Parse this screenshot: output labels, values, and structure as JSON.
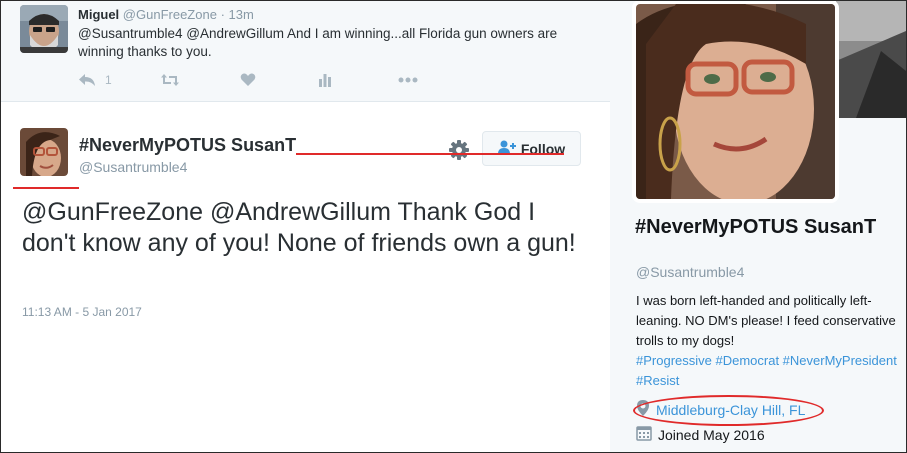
{
  "reply": {
    "name": "Miguel",
    "handle": "@GunFreeZone",
    "separator": "·",
    "time": "13m",
    "text": "@Susantrumble4 @AndrewGillum And I am winning...all Florida gun owners are winning thanks to you.",
    "actions": {
      "reply_count": "1",
      "reply_icon": "reply-icon",
      "retweet_icon": "retweet-icon",
      "like_icon": "heart-icon",
      "analytics_icon": "analytics-icon",
      "more_icon": "more-icon"
    }
  },
  "tweet": {
    "name": "#NeverMyPOTUS SusanT",
    "handle": "@Susantrumble4",
    "follow_label": "Follow",
    "text": "@GunFreeZone @AndrewGillum Thank God I don't know any of you!  None of friends own a gun!",
    "timestamp": "11:13 AM - 5 Jan 2017"
  },
  "profile": {
    "name": "#NeverMyPOTUS SusanT",
    "handle": "@Susantrumble4",
    "bio_text": "I was born left-handed and politically left-leaning. NO DM's please! I feed conservative trolls to my dogs!",
    "hashtags": "#Progressive #Democrat #NeverMyPresident #Resist",
    "location": "Middleburg-Clay Hill, FL",
    "joined": "Joined May 2016"
  },
  "colors": {
    "link": "#3b94d9",
    "annotation_red": "#e02a2a",
    "muted": "#8899a6",
    "panel_bg": "#f5f8fa"
  }
}
